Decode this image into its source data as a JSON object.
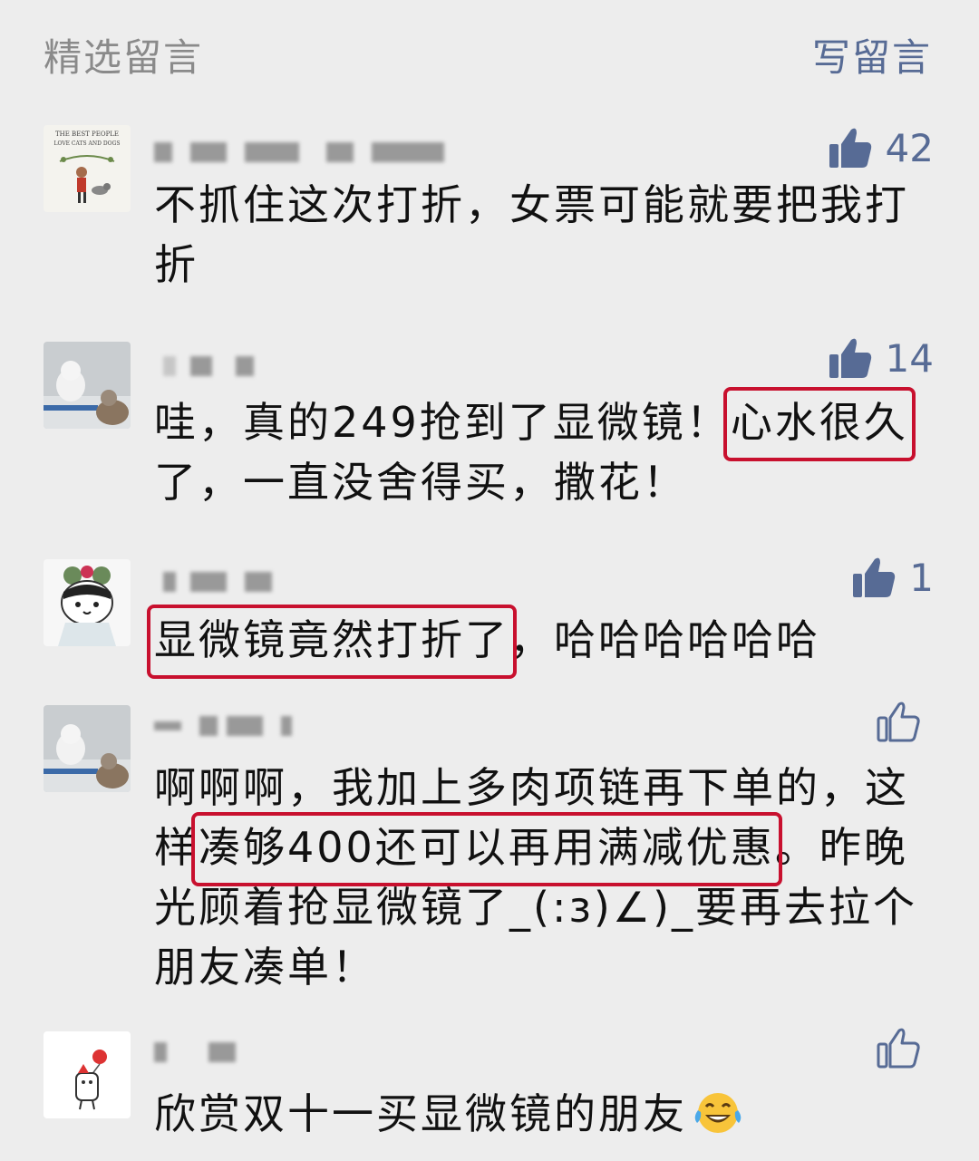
{
  "header": {
    "title": "精选留言",
    "write_label": "写留言"
  },
  "comments": [
    {
      "likes": "42",
      "liked_filled": true,
      "text": "不抓住这次打折，女票可能就要把我打折"
    },
    {
      "likes": "14",
      "liked_filled": true,
      "text_before": "哇，真的249抢到了显微镜！",
      "highlight": "心水很久",
      "text_after": "了，一直没舍得买，撒花！"
    },
    {
      "likes": "1",
      "liked_filled": true,
      "highlight": "显微镜竟然打折了",
      "text_after": "，哈哈哈哈哈哈"
    },
    {
      "likes": "",
      "liked_filled": false,
      "text_before": "啊啊啊，我加上多肉项链再下单的，这样",
      "highlight": "凑够400还可以再用满减优惠",
      "text_after": "。昨晚光顾着抢显微镜了_(:з)∠)_要再去拉个朋友凑单！"
    },
    {
      "likes": "",
      "liked_filled": false,
      "text": "欣赏双十一买显微镜的朋友"
    }
  ],
  "avatar_1": {
    "caption_line1": "THE BEST PEOPLE",
    "caption_line2": "LOVE CATS AND DOGS"
  },
  "colors": {
    "link": "#576b95",
    "highlight_border": "#c8102e",
    "background": "#ededed"
  },
  "icons": {
    "like": "thumbs-up-icon",
    "emoji": "laughing-tears-emoji"
  }
}
